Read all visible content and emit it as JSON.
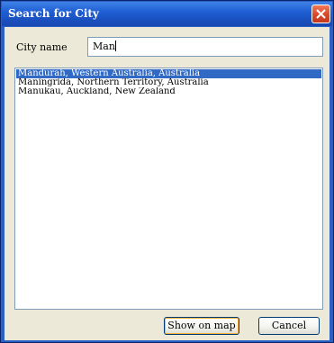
{
  "window": {
    "title": "Search for City"
  },
  "form": {
    "city_label": "City name",
    "city_value": "Man"
  },
  "results": [
    {
      "label": "Mandurah, Western Australia, Australia",
      "selected": true
    },
    {
      "label": "Maningrida, Northern Territory, Australia",
      "selected": false
    },
    {
      "label": "Manukau, Auckland, New Zealand",
      "selected": false
    }
  ],
  "buttons": {
    "show_on_map": "Show on map",
    "cancel": "Cancel"
  },
  "icons": {
    "close": "close-icon"
  },
  "colors": {
    "titlebar": "#1f5fd4",
    "selection": "#316ac5",
    "close_button": "#d9482b",
    "dialog_face": "#ece9d8"
  }
}
